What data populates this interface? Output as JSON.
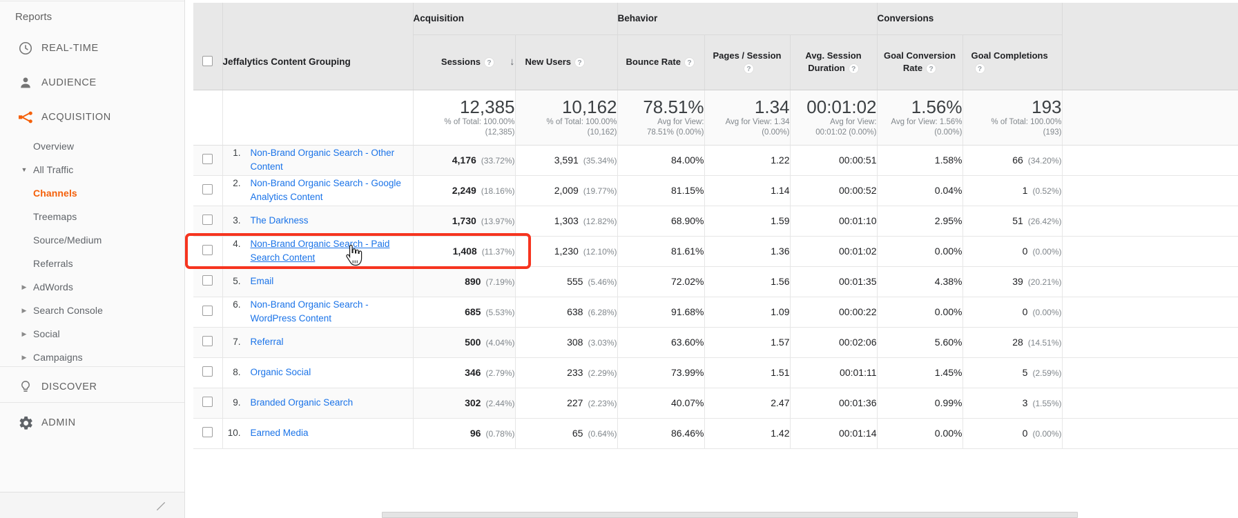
{
  "sidebar": {
    "reports_label": "Reports",
    "sections": [
      {
        "label": "REAL-TIME",
        "icon": "clock-icon"
      },
      {
        "label": "AUDIENCE",
        "icon": "person-icon"
      },
      {
        "label": "ACQUISITION",
        "icon": "acquisition-icon",
        "active": true
      }
    ],
    "acquisition_items": [
      {
        "label": "Overview",
        "arrow": "",
        "active": false
      },
      {
        "label": "All Traffic",
        "arrow": "down",
        "active": false
      },
      {
        "label": "Channels",
        "arrow": "",
        "active": true
      },
      {
        "label": "Treemaps",
        "arrow": "",
        "active": false
      },
      {
        "label": "Source/Medium",
        "arrow": "",
        "active": false
      },
      {
        "label": "Referrals",
        "arrow": "",
        "active": false
      },
      {
        "label": "AdWords",
        "arrow": "right",
        "active": false
      },
      {
        "label": "Search Console",
        "arrow": "right",
        "active": false
      },
      {
        "label": "Social",
        "arrow": "right",
        "active": false
      },
      {
        "label": "Campaigns",
        "arrow": "right",
        "active": false
      }
    ],
    "footer_sections": [
      {
        "label": "DISCOVER",
        "icon": "lightbulb-icon"
      },
      {
        "label": "ADMIN",
        "icon": "gear-icon"
      }
    ],
    "collapse_icon": "collapse-arrow-icon",
    "accent_color": "#f4600a"
  },
  "table": {
    "dimension_header": "Jeffalytics Content Grouping",
    "group_headers": [
      {
        "label": "Acquisition"
      },
      {
        "label": "Behavior"
      },
      {
        "label": "Conversions"
      }
    ],
    "metric_headers": [
      {
        "label": "Sessions",
        "help": "?",
        "sorted": true,
        "sort_dir": "↓"
      },
      {
        "label": "New Users",
        "help": "?"
      },
      {
        "label": "Bounce Rate",
        "help": "?"
      },
      {
        "label": "Pages / Session",
        "help": "?"
      },
      {
        "label": "Avg. Session Duration",
        "help": "?"
      },
      {
        "label": "Goal Conversion Rate",
        "help": "?"
      },
      {
        "label": "Goal Completions",
        "help": "?"
      }
    ],
    "summary": [
      {
        "value": "12,385",
        "note1": "% of Total: 100.00%",
        "note2": "(12,385)"
      },
      {
        "value": "10,162",
        "note1": "% of Total: 100.00%",
        "note2": "(10,162)"
      },
      {
        "value": "78.51%",
        "note1": "Avg for View:",
        "note2": "78.51% (0.00%)"
      },
      {
        "value": "1.34",
        "note1": "Avg for View: 1.34",
        "note2": "(0.00%)"
      },
      {
        "value": "00:01:02",
        "note1": "Avg for View:",
        "note2": "00:01:02 (0.00%)"
      },
      {
        "value": "1.56%",
        "note1": "Avg for View: 1.56%",
        "note2": "(0.00%)"
      },
      {
        "value": "193",
        "note1": "% of Total: 100.00%",
        "note2": "(193)"
      }
    ],
    "rows": [
      {
        "rank": "1.",
        "name": "Non-Brand Organic Search - Other Content",
        "sessions": "4,176",
        "sessions_pct": "(33.72%)",
        "new_users": "3,591",
        "new_users_pct": "(35.34%)",
        "bounce_rate": "84.00%",
        "pages_session": "1.22",
        "avg_duration": "00:00:51",
        "goal_rate": "1.58%",
        "goal_completions": "66",
        "goal_completions_pct": "(34.20%)",
        "highlighted": false,
        "hovered": false
      },
      {
        "rank": "2.",
        "name": "Non-Brand Organic Search - Google Analytics Content",
        "sessions": "2,249",
        "sessions_pct": "(18.16%)",
        "new_users": "2,009",
        "new_users_pct": "(19.77%)",
        "bounce_rate": "81.15%",
        "pages_session": "1.14",
        "avg_duration": "00:00:52",
        "goal_rate": "0.04%",
        "goal_completions": "1",
        "goal_completions_pct": "(0.52%)",
        "highlighted": false,
        "hovered": false
      },
      {
        "rank": "3.",
        "name": "The Darkness",
        "sessions": "1,730",
        "sessions_pct": "(13.97%)",
        "new_users": "1,303",
        "new_users_pct": "(12.82%)",
        "bounce_rate": "68.90%",
        "pages_session": "1.59",
        "avg_duration": "00:01:10",
        "goal_rate": "2.95%",
        "goal_completions": "51",
        "goal_completions_pct": "(26.42%)",
        "highlighted": false,
        "hovered": false
      },
      {
        "rank": "4.",
        "name": "Non-Brand Organic Search - Paid Search Content",
        "sessions": "1,408",
        "sessions_pct": "(11.37%)",
        "new_users": "1,230",
        "new_users_pct": "(12.10%)",
        "bounce_rate": "81.61%",
        "pages_session": "1.36",
        "avg_duration": "00:01:02",
        "goal_rate": "0.00%",
        "goal_completions": "0",
        "goal_completions_pct": "(0.00%)",
        "highlighted": true,
        "hovered": true
      },
      {
        "rank": "5.",
        "name": "Email",
        "sessions": "890",
        "sessions_pct": "(7.19%)",
        "new_users": "555",
        "new_users_pct": "(5.46%)",
        "bounce_rate": "72.02%",
        "pages_session": "1.56",
        "avg_duration": "00:01:35",
        "goal_rate": "4.38%",
        "goal_completions": "39",
        "goal_completions_pct": "(20.21%)",
        "highlighted": false,
        "hovered": false
      },
      {
        "rank": "6.",
        "name": "Non-Brand Organic Search - WordPress Content",
        "sessions": "685",
        "sessions_pct": "(5.53%)",
        "new_users": "638",
        "new_users_pct": "(6.28%)",
        "bounce_rate": "91.68%",
        "pages_session": "1.09",
        "avg_duration": "00:00:22",
        "goal_rate": "0.00%",
        "goal_completions": "0",
        "goal_completions_pct": "(0.00%)",
        "highlighted": false,
        "hovered": false
      },
      {
        "rank": "7.",
        "name": "Referral",
        "sessions": "500",
        "sessions_pct": "(4.04%)",
        "new_users": "308",
        "new_users_pct": "(3.03%)",
        "bounce_rate": "63.60%",
        "pages_session": "1.57",
        "avg_duration": "00:02:06",
        "goal_rate": "5.60%",
        "goal_completions": "28",
        "goal_completions_pct": "(14.51%)",
        "highlighted": false,
        "hovered": false
      },
      {
        "rank": "8.",
        "name": "Organic Social",
        "sessions": "346",
        "sessions_pct": "(2.79%)",
        "new_users": "233",
        "new_users_pct": "(2.29%)",
        "bounce_rate": "73.99%",
        "pages_session": "1.51",
        "avg_duration": "00:01:11",
        "goal_rate": "1.45%",
        "goal_completions": "5",
        "goal_completions_pct": "(2.59%)",
        "highlighted": false,
        "hovered": false
      },
      {
        "rank": "9.",
        "name": "Branded Organic Search",
        "sessions": "302",
        "sessions_pct": "(2.44%)",
        "new_users": "227",
        "new_users_pct": "(2.23%)",
        "bounce_rate": "40.07%",
        "pages_session": "2.47",
        "avg_duration": "00:01:36",
        "goal_rate": "0.99%",
        "goal_completions": "3",
        "goal_completions_pct": "(1.55%)",
        "highlighted": false,
        "hovered": false
      },
      {
        "rank": "10.",
        "name": "Earned Media",
        "sessions": "96",
        "sessions_pct": "(0.78%)",
        "new_users": "65",
        "new_users_pct": "(0.64%)",
        "bounce_rate": "86.46%",
        "pages_session": "1.42",
        "avg_duration": "00:01:14",
        "goal_rate": "0.00%",
        "goal_completions": "0",
        "goal_completions_pct": "(0.00%)",
        "highlighted": false,
        "hovered": false
      }
    ]
  },
  "highlight": {
    "color": "#f6341f"
  },
  "cursor": {
    "type": "pointer-hand-cursor"
  }
}
